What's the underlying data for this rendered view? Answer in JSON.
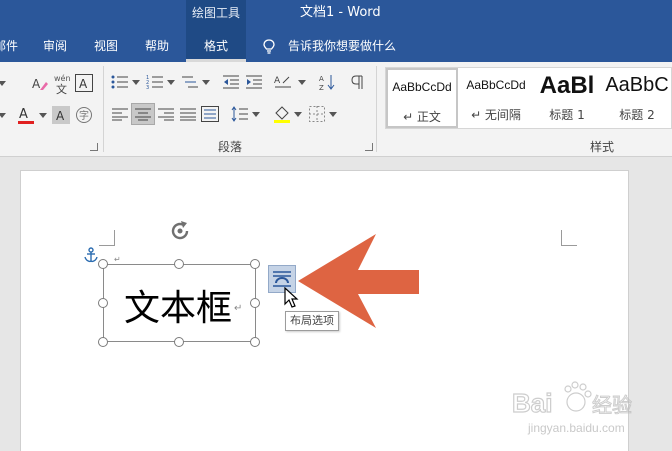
{
  "title_bar": {
    "context_group": "绘图工具",
    "document_title": "文档1  -  Word"
  },
  "tabs": [
    {
      "label": "邮件"
    },
    {
      "label": "审阅"
    },
    {
      "label": "视图"
    },
    {
      "label": "帮助"
    },
    {
      "label": "格式",
      "active": true
    }
  ],
  "tell_me": {
    "label": "告诉我你想要做什么",
    "icon": "lightbulb-icon"
  },
  "ribbon": {
    "groups": {
      "paragraph": "段落",
      "styles": "样式"
    },
    "styles": [
      {
        "sample": "AaBbCcDd",
        "name": "↵ 正文",
        "selected": true
      },
      {
        "sample": "AaBbCcDd",
        "name": "↵ 无间隔"
      },
      {
        "sample": "AaBl",
        "name": "标题 1"
      },
      {
        "sample": "AaBbC",
        "name": "标题 2"
      }
    ],
    "font_color": "#e02020",
    "highlight_color": "#ffff00"
  },
  "document": {
    "textbox_text": "文本框",
    "layout_options_tooltip": "布局选项",
    "arrow_color": "#de6442"
  },
  "watermark": {
    "text": "Baidu 经验",
    "url": "jingyan.baidu.com"
  },
  "colors": {
    "title_bar": "#2b579a",
    "active_tab": "#1f4a85",
    "ribbon": "#f3f3f3",
    "workspace": "#e6e6e6"
  }
}
